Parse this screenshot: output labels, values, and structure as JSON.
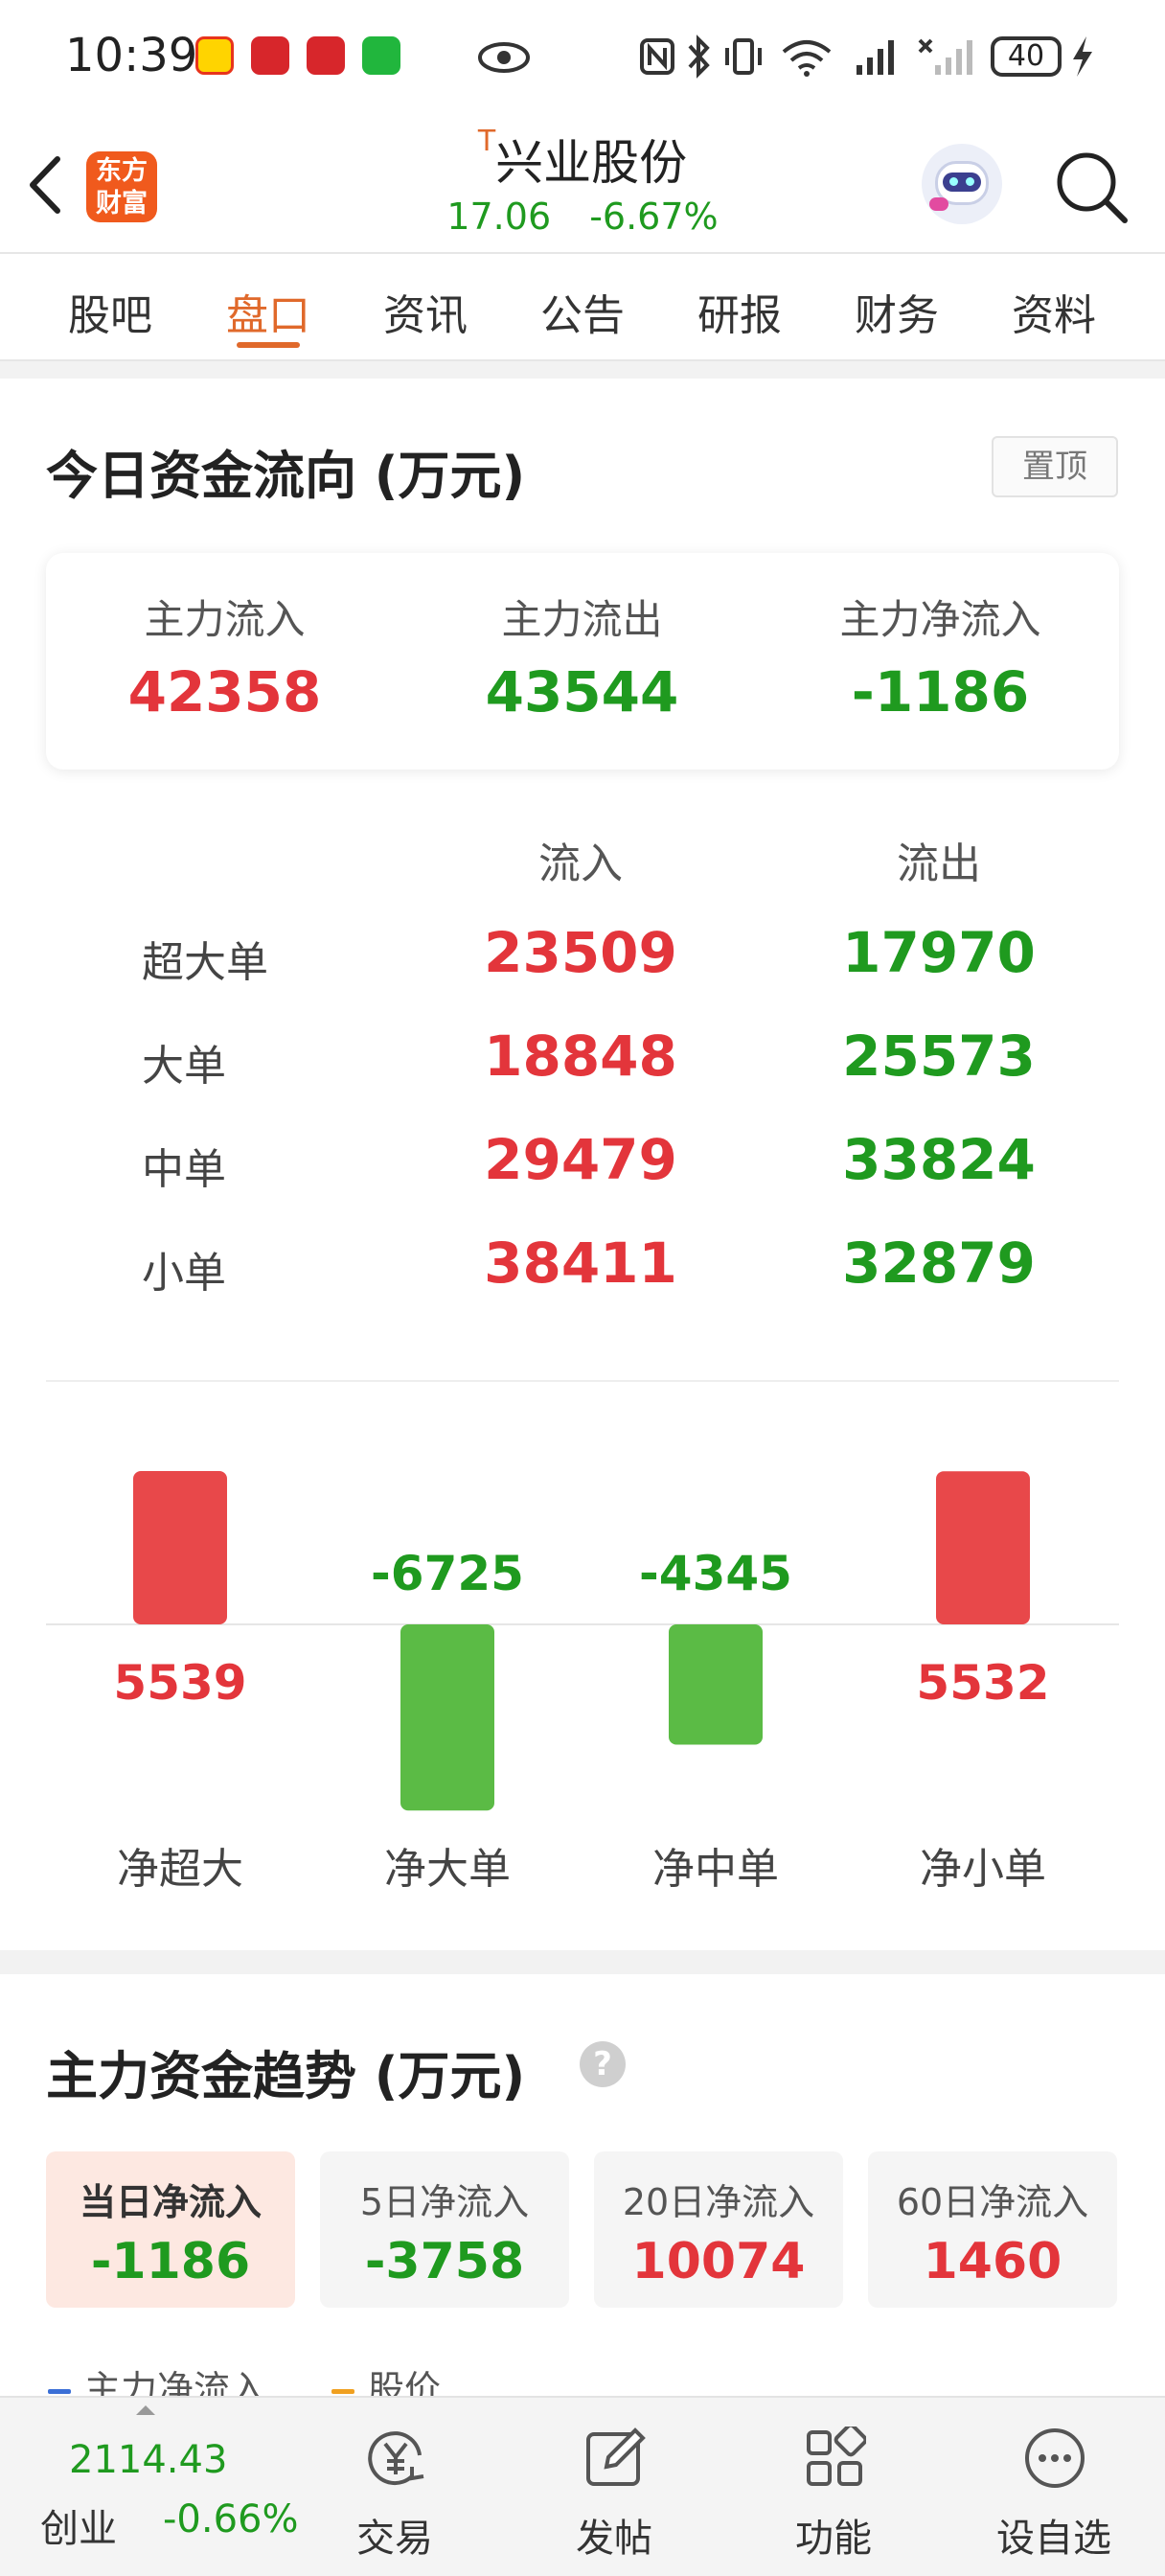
{
  "status_bar": {
    "time": "10:39",
    "battery": "40"
  },
  "header": {
    "stock_name": "兴业股份",
    "stock_prefix": "T",
    "price": "17.06",
    "change_pct": "-6.67%",
    "logo_line1": "东方",
    "logo_line2": "财富"
  },
  "tabs": [
    {
      "label": "股吧",
      "active": false
    },
    {
      "label": "盘口",
      "active": true
    },
    {
      "label": "资讯",
      "active": false
    },
    {
      "label": "公告",
      "active": false
    },
    {
      "label": "研报",
      "active": false
    },
    {
      "label": "财务",
      "active": false
    },
    {
      "label": "资料",
      "active": false
    }
  ],
  "flow": {
    "title": "今日资金流向 (万元)",
    "pin_label": "置顶",
    "summary": [
      {
        "label": "主力流入",
        "value": "42358",
        "color": "red"
      },
      {
        "label": "主力流出",
        "value": "43544",
        "color": "green"
      },
      {
        "label": "主力净流入",
        "value": "-1186",
        "color": "green"
      }
    ],
    "col_in": "流入",
    "col_out": "流出",
    "rows": [
      {
        "label": "超大单",
        "inflow": "23509",
        "outflow": "17970"
      },
      {
        "label": "大单",
        "inflow": "18848",
        "outflow": "25573"
      },
      {
        "label": "中单",
        "inflow": "29479",
        "outflow": "33824"
      },
      {
        "label": "小单",
        "inflow": "38411",
        "outflow": "32879"
      }
    ]
  },
  "chart_data": {
    "type": "bar",
    "title": "",
    "xlabel": "",
    "ylabel": "",
    "categories": [
      "净超大",
      "净大单",
      "净中单",
      "净小单"
    ],
    "values": [
      5539,
      -6725,
      -4345,
      5532
    ],
    "positive_color": "#e8484a",
    "negative_color": "#5bbb45"
  },
  "trend": {
    "title": "主力资金趋势 (万元)",
    "help": "?",
    "periods": [
      {
        "label": "当日净流入",
        "value": "-1186",
        "color": "green",
        "active": true
      },
      {
        "label": "5日净流入",
        "value": "-3758",
        "color": "green",
        "active": false
      },
      {
        "label": "20日净流入",
        "value": "10074",
        "color": "red",
        "active": false
      },
      {
        "label": "60日净流入",
        "value": "1460",
        "color": "red",
        "active": false
      }
    ],
    "legend": [
      {
        "label": "主力净流入",
        "color": "#3b6fd6"
      },
      {
        "label": "股价",
        "color": "#f0a020"
      }
    ]
  },
  "bottom_nav": {
    "index_value": "2114.43",
    "index_name": "创业",
    "index_change": "-0.66%",
    "items": [
      {
        "label": "交易",
        "icon": "yen-refresh-icon"
      },
      {
        "label": "发帖",
        "icon": "edit-icon"
      },
      {
        "label": "功能",
        "icon": "grid-icon"
      },
      {
        "label": "设自选",
        "icon": "more-circle-icon"
      }
    ]
  }
}
